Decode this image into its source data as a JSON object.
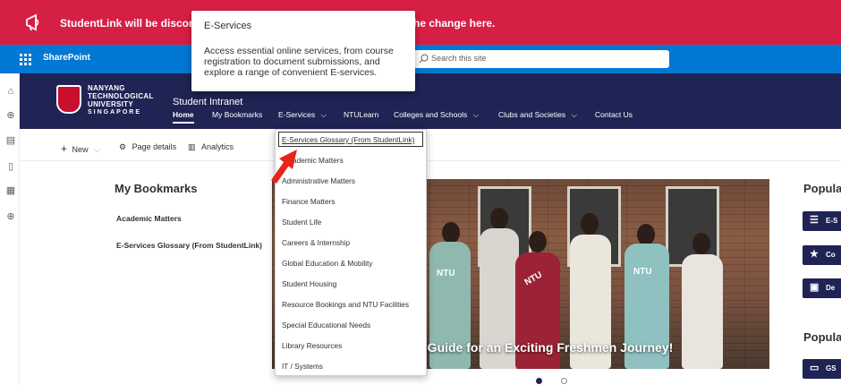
{
  "banner": {
    "text_left": "StudentLink will be disconti",
    "text_right": "he change here.",
    "color": "#d61f45"
  },
  "suitebar": {
    "app_name": "SharePoint",
    "search_placeholder": "Search this site",
    "color": "#0078d4"
  },
  "site": {
    "logo_lines": [
      "NANYANG",
      "TECHNOLOGICAL",
      "UNIVERSITY",
      "SINGAPORE"
    ],
    "title": "Student Intranet",
    "nav": {
      "home": "Home",
      "bookmarks": "My Bookmarks",
      "eservices": "E-Services",
      "ntulearn": "NTULearn",
      "colleges": "Colleges and Schools",
      "clubs": "Clubs and Societies",
      "contact": "Contact Us"
    },
    "header_color": "#1f2454"
  },
  "commandbar": {
    "new": "New",
    "page_details": "Page details",
    "analytics": "Analytics"
  },
  "bookmarks": {
    "title": "My Bookmarks",
    "items": [
      "Academic Matters",
      "E-Services Glossary (From StudentLink)"
    ]
  },
  "hero": {
    "caption": "e Guide for an Exciting Freshmen Journey!",
    "shirt_texts": [
      "NTU",
      "NTU",
      "NTU"
    ]
  },
  "popular": {
    "title_1": "Popular",
    "title_2": "Popular",
    "buttons": [
      "E-S",
      "Co",
      "De",
      "GS"
    ]
  },
  "tooltip": {
    "title": "E-Services",
    "body": "Access essential online services, from course registration to document submissions, and explore a range of convenient E-services."
  },
  "dropdown": {
    "items": [
      "E-Services Glossary (From StudentLink)",
      "ademic Matters",
      "Administrative Matters",
      "Finance Matters",
      "Student Life",
      "Careers & Internship",
      "Global Education & Mobility",
      "Student Housing",
      "Resource Bookings and NTU Facilities",
      "Special Educational Needs",
      "Library Resources",
      "IT / Systems"
    ]
  },
  "colors": {
    "accent": "#0078d4",
    "navy": "#1f2454",
    "alert": "#d61f45",
    "arrow": "#e8231a"
  }
}
